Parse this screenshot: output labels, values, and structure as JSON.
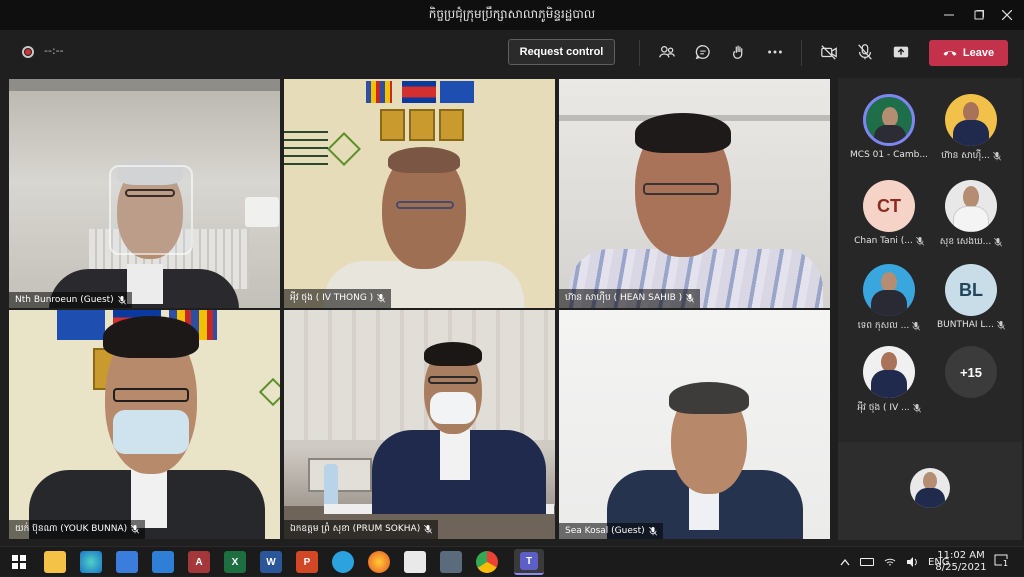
{
  "window": {
    "title": "កិច្ចប្រជុំក្រុមប្រឹក្សាសាលាភូមិន្ទរដ្ឋបាល",
    "controls": [
      "minimize",
      "maximize",
      "close"
    ]
  },
  "toolbar": {
    "recording_timer": "--:--",
    "request_control_label": "Request control",
    "leave_label": "Leave",
    "icons": [
      "people-icon",
      "chat-icon",
      "reactions-icon",
      "more-icon",
      "camera-off-icon",
      "mic-off-icon",
      "share-icon"
    ],
    "accent_leave": "#c4314b"
  },
  "participants": [
    {
      "name": "Nth Bunroeun (Guest)",
      "muted": true
    },
    {
      "name": "អុីវ ថុង ( IV THONG )",
      "muted": true
    },
    {
      "name": "ហ៊ាន សាហ៊ីប ( HEAN SAHIB )",
      "muted": true
    },
    {
      "name": "យក់ ប៊ុនណា (YOUK BUNNA)",
      "muted": true
    },
    {
      "name": "ឯកឧត្តម ព្រំ សុខា (PRUM SOKHA)",
      "muted": true
    },
    {
      "name": "Sea Kosal (Guest)",
      "muted": true
    }
  ],
  "roster": [
    {
      "label": "MCS 01 - Camb...",
      "initials": "",
      "muted": false
    },
    {
      "label": "ហ៊ាន សាហ៊ី...",
      "initials": "",
      "muted": true
    },
    {
      "label": "Chan Tani (...",
      "initials": "CT",
      "muted": true
    },
    {
      "label": "សុខ សេងឃ...",
      "initials": "",
      "muted": true
    },
    {
      "label": "ទេព កុសល ...",
      "initials": "",
      "muted": true
    },
    {
      "label": "BUNTHAI L...",
      "initials": "BL",
      "muted": true
    },
    {
      "label": "អុីវ ថុង ( IV ...",
      "initials": "",
      "muted": true
    },
    {
      "label": "",
      "initials": "+15",
      "muted": false
    }
  ],
  "taskbar": {
    "apps": [
      "start",
      "search",
      "task-view",
      "file-explorer",
      "edge",
      "store",
      "mail",
      "access",
      "excel",
      "word",
      "powerpoint",
      "telegram",
      "firefox",
      "snipping",
      "camera",
      "chrome",
      "teams"
    ],
    "language": "ENG",
    "time": "11:02 AM",
    "date": "8/25/2021",
    "notifications": "1"
  }
}
